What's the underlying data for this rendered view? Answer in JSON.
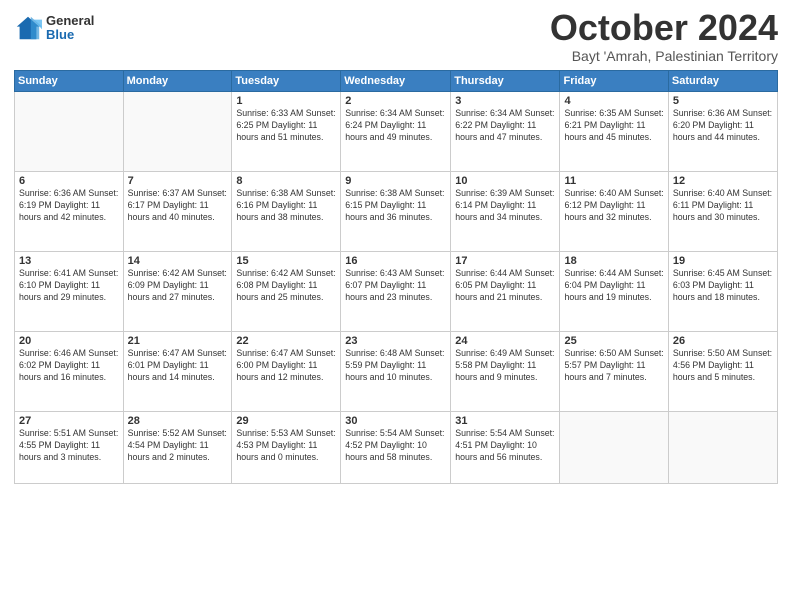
{
  "logo": {
    "general": "General",
    "blue": "Blue"
  },
  "header": {
    "month": "October 2024",
    "location": "Bayt 'Amrah, Palestinian Territory"
  },
  "weekdays": [
    "Sunday",
    "Monday",
    "Tuesday",
    "Wednesday",
    "Thursday",
    "Friday",
    "Saturday"
  ],
  "weeks": [
    [
      {
        "day": "",
        "info": ""
      },
      {
        "day": "",
        "info": ""
      },
      {
        "day": "1",
        "info": "Sunrise: 6:33 AM\nSunset: 6:25 PM\nDaylight: 11 hours and 51 minutes."
      },
      {
        "day": "2",
        "info": "Sunrise: 6:34 AM\nSunset: 6:24 PM\nDaylight: 11 hours and 49 minutes."
      },
      {
        "day": "3",
        "info": "Sunrise: 6:34 AM\nSunset: 6:22 PM\nDaylight: 11 hours and 47 minutes."
      },
      {
        "day": "4",
        "info": "Sunrise: 6:35 AM\nSunset: 6:21 PM\nDaylight: 11 hours and 45 minutes."
      },
      {
        "day": "5",
        "info": "Sunrise: 6:36 AM\nSunset: 6:20 PM\nDaylight: 11 hours and 44 minutes."
      }
    ],
    [
      {
        "day": "6",
        "info": "Sunrise: 6:36 AM\nSunset: 6:19 PM\nDaylight: 11 hours and 42 minutes."
      },
      {
        "day": "7",
        "info": "Sunrise: 6:37 AM\nSunset: 6:17 PM\nDaylight: 11 hours and 40 minutes."
      },
      {
        "day": "8",
        "info": "Sunrise: 6:38 AM\nSunset: 6:16 PM\nDaylight: 11 hours and 38 minutes."
      },
      {
        "day": "9",
        "info": "Sunrise: 6:38 AM\nSunset: 6:15 PM\nDaylight: 11 hours and 36 minutes."
      },
      {
        "day": "10",
        "info": "Sunrise: 6:39 AM\nSunset: 6:14 PM\nDaylight: 11 hours and 34 minutes."
      },
      {
        "day": "11",
        "info": "Sunrise: 6:40 AM\nSunset: 6:12 PM\nDaylight: 11 hours and 32 minutes."
      },
      {
        "day": "12",
        "info": "Sunrise: 6:40 AM\nSunset: 6:11 PM\nDaylight: 11 hours and 30 minutes."
      }
    ],
    [
      {
        "day": "13",
        "info": "Sunrise: 6:41 AM\nSunset: 6:10 PM\nDaylight: 11 hours and 29 minutes."
      },
      {
        "day": "14",
        "info": "Sunrise: 6:42 AM\nSunset: 6:09 PM\nDaylight: 11 hours and 27 minutes."
      },
      {
        "day": "15",
        "info": "Sunrise: 6:42 AM\nSunset: 6:08 PM\nDaylight: 11 hours and 25 minutes."
      },
      {
        "day": "16",
        "info": "Sunrise: 6:43 AM\nSunset: 6:07 PM\nDaylight: 11 hours and 23 minutes."
      },
      {
        "day": "17",
        "info": "Sunrise: 6:44 AM\nSunset: 6:05 PM\nDaylight: 11 hours and 21 minutes."
      },
      {
        "day": "18",
        "info": "Sunrise: 6:44 AM\nSunset: 6:04 PM\nDaylight: 11 hours and 19 minutes."
      },
      {
        "day": "19",
        "info": "Sunrise: 6:45 AM\nSunset: 6:03 PM\nDaylight: 11 hours and 18 minutes."
      }
    ],
    [
      {
        "day": "20",
        "info": "Sunrise: 6:46 AM\nSunset: 6:02 PM\nDaylight: 11 hours and 16 minutes."
      },
      {
        "day": "21",
        "info": "Sunrise: 6:47 AM\nSunset: 6:01 PM\nDaylight: 11 hours and 14 minutes."
      },
      {
        "day": "22",
        "info": "Sunrise: 6:47 AM\nSunset: 6:00 PM\nDaylight: 11 hours and 12 minutes."
      },
      {
        "day": "23",
        "info": "Sunrise: 6:48 AM\nSunset: 5:59 PM\nDaylight: 11 hours and 10 minutes."
      },
      {
        "day": "24",
        "info": "Sunrise: 6:49 AM\nSunset: 5:58 PM\nDaylight: 11 hours and 9 minutes."
      },
      {
        "day": "25",
        "info": "Sunrise: 6:50 AM\nSunset: 5:57 PM\nDaylight: 11 hours and 7 minutes."
      },
      {
        "day": "26",
        "info": "Sunrise: 5:50 AM\nSunset: 4:56 PM\nDaylight: 11 hours and 5 minutes."
      }
    ],
    [
      {
        "day": "27",
        "info": "Sunrise: 5:51 AM\nSunset: 4:55 PM\nDaylight: 11 hours and 3 minutes."
      },
      {
        "day": "28",
        "info": "Sunrise: 5:52 AM\nSunset: 4:54 PM\nDaylight: 11 hours and 2 minutes."
      },
      {
        "day": "29",
        "info": "Sunrise: 5:53 AM\nSunset: 4:53 PM\nDaylight: 11 hours and 0 minutes."
      },
      {
        "day": "30",
        "info": "Sunrise: 5:54 AM\nSunset: 4:52 PM\nDaylight: 10 hours and 58 minutes."
      },
      {
        "day": "31",
        "info": "Sunrise: 5:54 AM\nSunset: 4:51 PM\nDaylight: 10 hours and 56 minutes."
      },
      {
        "day": "",
        "info": ""
      },
      {
        "day": "",
        "info": ""
      }
    ]
  ]
}
